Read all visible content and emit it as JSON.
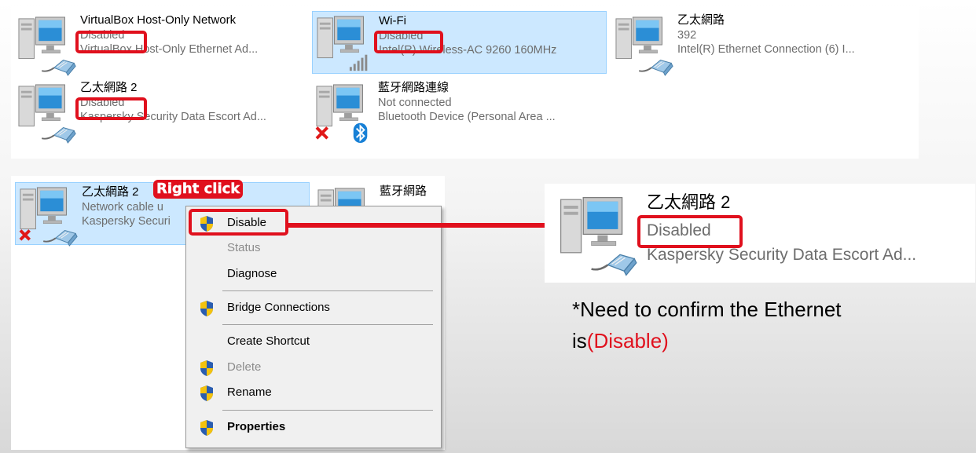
{
  "top_panel": {
    "adapters": [
      {
        "name": "VirtualBox Host-Only Network",
        "status": "Disabled",
        "device": "VirtualBox Host-Only Ethernet Ad..."
      },
      {
        "name": "Wi-Fi",
        "status": "Disabled",
        "device": "Intel(R) Wireless-AC 9260 160MHz"
      },
      {
        "name": "乙太網路",
        "status": "392",
        "device": "Intel(R) Ethernet Connection (6) I..."
      },
      {
        "name": "乙太網路 2",
        "status": "Disabled",
        "device": "Kaspersky Security Data Escort Ad..."
      },
      {
        "name": "藍牙網路連線",
        "status": "Not connected",
        "device": "Bluetooth Device (Personal Area ..."
      }
    ]
  },
  "left_panel": {
    "adapter": {
      "name": "乙太網路 2",
      "status": "Network cable u",
      "device": "Kaspersky Securi"
    },
    "adapter2_name": "藍牙網路",
    "callout": "Right click"
  },
  "context_menu": {
    "items": [
      {
        "label": "Disable",
        "icon": "shield-icon",
        "enabled": true,
        "bold": false
      },
      {
        "label": "Status",
        "icon": "",
        "enabled": false,
        "bold": false
      },
      {
        "label": "Diagnose",
        "icon": "",
        "enabled": true,
        "bold": false
      },
      {
        "label": "Bridge Connections",
        "icon": "shield-icon",
        "enabled": true,
        "bold": false
      },
      {
        "label": "Create Shortcut",
        "icon": "",
        "enabled": true,
        "bold": false
      },
      {
        "label": "Delete",
        "icon": "shield-icon",
        "enabled": false,
        "bold": false
      },
      {
        "label": "Rename",
        "icon": "shield-icon",
        "enabled": true,
        "bold": false
      },
      {
        "label": "Properties",
        "icon": "shield-icon",
        "enabled": true,
        "bold": true
      }
    ]
  },
  "result_panel": {
    "adapter": {
      "name": "乙太網路 2",
      "status": "Disabled",
      "device": "Kaspersky Security Data Escort Ad..."
    }
  },
  "note": {
    "line1": "*Need to confirm the Ethernet",
    "line2_prefix": "is",
    "line2_highlight": "(Disable)"
  },
  "colors": {
    "highlight": "#e0101d",
    "selection": "#cce8ff",
    "note_red": "#e0101d"
  }
}
